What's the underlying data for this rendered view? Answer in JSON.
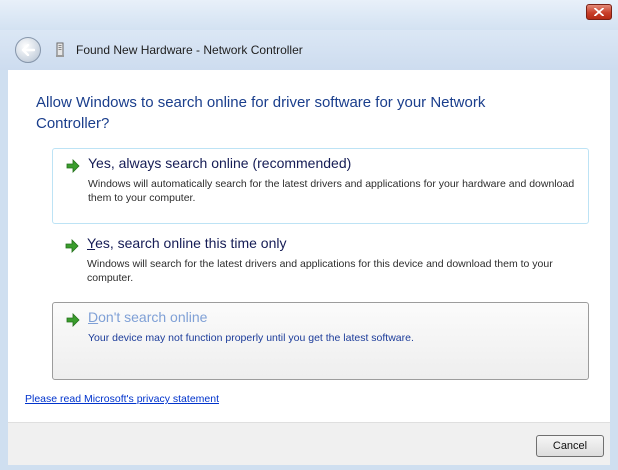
{
  "window": {
    "title": "Found New Hardware - Network Controller",
    "accent": "#1a3e8c"
  },
  "heading": "Allow Windows to search online for driver software for your Network Controller?",
  "options": [
    {
      "title": "Yes, always search online (recommended)",
      "description": "Windows will automatically search for the latest drivers and applications for your hardware and download them to your computer.",
      "state": "hover"
    },
    {
      "title_accel": "Y",
      "title_rest": "es, search online this time only",
      "description": "Windows will search for the latest drivers and applications for this device and download them to your computer.",
      "state": "normal"
    },
    {
      "title_accel": "D",
      "title_rest": "on't search online",
      "description": "Your device may not function properly until you get the latest software.",
      "state": "selected"
    }
  ],
  "privacy_link": "Please read Microsoft's privacy statement",
  "footer": {
    "cancel_label": "Cancel"
  },
  "icons": {
    "close": "close-icon",
    "back": "back-arrow-icon",
    "wizard": "hardware-icon",
    "option_arrow": "green-arrow-icon"
  }
}
